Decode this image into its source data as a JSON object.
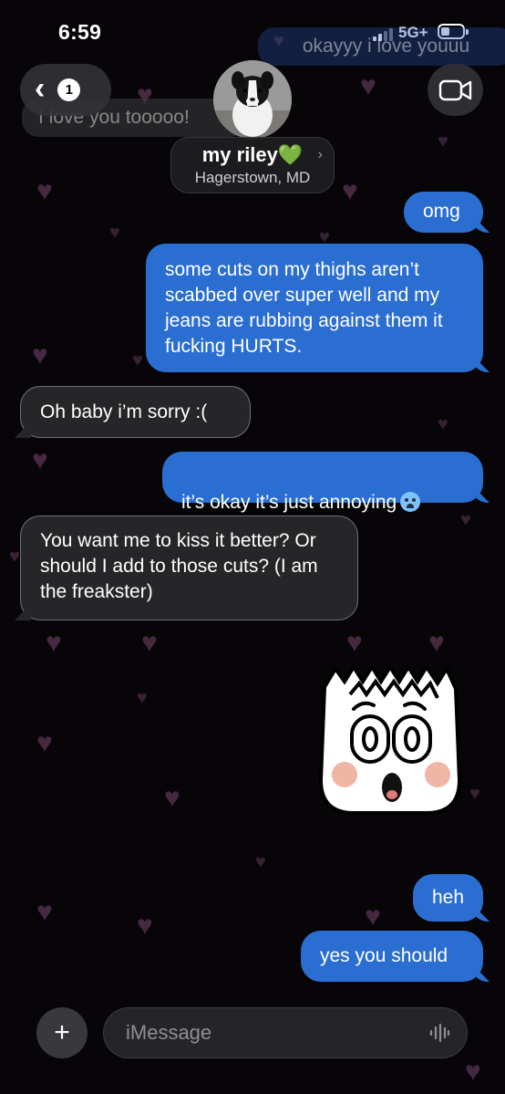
{
  "status": {
    "time": "6:59",
    "network": "5G+"
  },
  "history": [
    "okayyy i love youuu",
    "I love you tooooo!"
  ],
  "header": {
    "back_count": "1",
    "contact_name": "my riley💚",
    "contact_location": "Hagerstown, MD"
  },
  "messages": [
    {
      "from": "me",
      "text": "omg"
    },
    {
      "from": "me",
      "text": "some cuts on my thighs aren’t scabbed over super well and my jeans are rubbing against them it fucking HURTS."
    },
    {
      "from": "them",
      "text": "Oh baby i’m sorry :("
    },
    {
      "from": "me",
      "text": "it’s okay it’s just annoying"
    },
    {
      "from": "them",
      "text": "You want me to kiss it better? Or should I add to those cuts? (I am the freakster)"
    },
    {
      "from": "me",
      "text": "heh"
    },
    {
      "from": "me",
      "text": "yes you should"
    }
  ],
  "composer": {
    "placeholder": "iMessage"
  },
  "colors": {
    "sent": "#2b6ed1",
    "received": "#262628",
    "background": "#070508",
    "hearts": "#5b3454"
  },
  "icons": [
    "back-chevron-icon",
    "video-camera-icon",
    "plus-icon",
    "waveform-icon",
    "emoji-crying-icon",
    "sticker-face"
  ]
}
